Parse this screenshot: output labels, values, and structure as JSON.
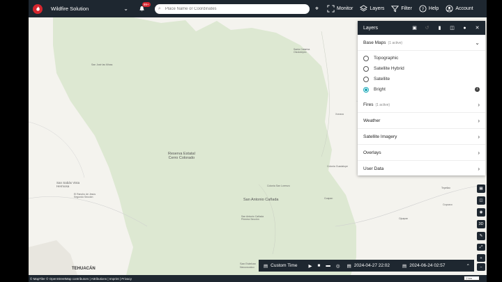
{
  "header": {
    "app_name": "Wildfire Solution",
    "notif_badge": "99+",
    "search_placeholder": "Place Name or Coordinates",
    "nav": [
      {
        "label": "Monitor"
      },
      {
        "label": "Layers"
      },
      {
        "label": "Filter"
      },
      {
        "label": "Help"
      },
      {
        "label": "Account"
      }
    ]
  },
  "layers_panel": {
    "title": "Layers",
    "base_maps": {
      "label": "Base Maps",
      "count": "(1 active)",
      "options": [
        {
          "label": "Topographic",
          "selected": false
        },
        {
          "label": "Satellite Hybrid",
          "selected": false
        },
        {
          "label": "Satellite",
          "selected": false
        },
        {
          "label": "Bright",
          "selected": true
        }
      ]
    },
    "sections": [
      {
        "label": "Fires",
        "count": "(1 active)"
      },
      {
        "label": "Weather",
        "count": ""
      },
      {
        "label": "Satellite Imagery",
        "count": ""
      },
      {
        "label": "Overlays",
        "count": ""
      },
      {
        "label": "User Data",
        "count": ""
      }
    ]
  },
  "map_labels": {
    "reserve": "Reserva Estatal\nCerro Colorado",
    "san_antonio": "San Antonio Cañada",
    "tehuacan": "TEHUACÁN",
    "san_sabas": "San Sabás Vista\nHermosa",
    "santa_catarina": "Santa Catarina\nOtzolotepec",
    "san_jose": "San José las Minas",
    "el_rancho": "El Rancho de Jesús\nSegundo Sección",
    "cerro_colorado": "Colonia San Lorenzo",
    "san_antonio_small": "San Antonio Cañada\nPrimera Sección",
    "san_esteban": "San Esteban\nNecoxcalco",
    "colonia": "Colonia Guadalupe",
    "right1": "Xonaca",
    "right2": "Tepetlax",
    "right3": "Coapan",
    "right4": "Cuyoaco",
    "right5": "Ojuapan"
  },
  "timebar": {
    "mode": "Custom Time",
    "start": "2024-04-27 22:02",
    "end": "2024-06-24 02:57"
  },
  "toolbar_3d": "3D",
  "attribution": "© MapTiler © OpenStreetMap contributors | Attributions | Imprint | Privacy",
  "scale": "2 km",
  "colors": {
    "nav_bg": "#1e2730",
    "brand_red": "#d6262f",
    "accent_teal": "#19a8b8",
    "forest_green": "#dde8d2"
  }
}
